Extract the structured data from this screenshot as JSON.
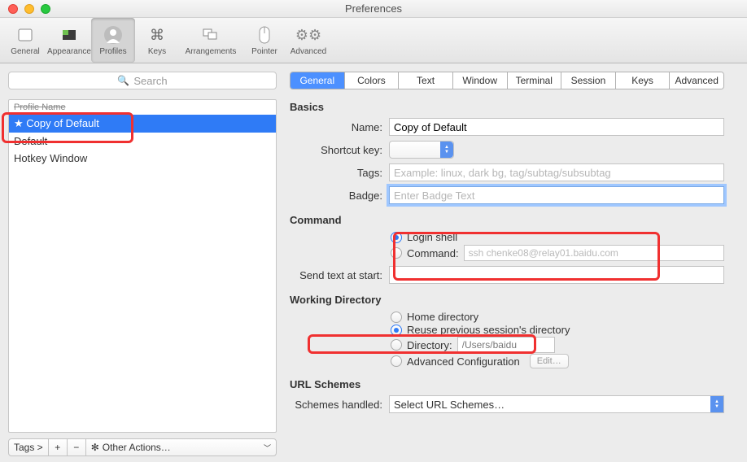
{
  "window": {
    "title": "Preferences"
  },
  "toolbar": {
    "items": [
      {
        "label": "General",
        "icon": "rect"
      },
      {
        "label": "Appearance",
        "icon": "swatch"
      },
      {
        "label": "Profiles",
        "icon": "person",
        "active": true
      },
      {
        "label": "Keys",
        "icon": "cmd"
      },
      {
        "label": "Arrangements",
        "icon": "windows"
      },
      {
        "label": "Pointer",
        "icon": "mouse"
      },
      {
        "label": "Advanced",
        "icon": "gears"
      }
    ]
  },
  "search": {
    "placeholder": "Search"
  },
  "profiles": {
    "header": "Profile Name",
    "items": [
      {
        "label": "★ Copy of Default",
        "selected": true
      },
      {
        "label": "Default"
      },
      {
        "label": "Hotkey Window"
      }
    ]
  },
  "sidebar_actions": {
    "tags": "Tags >",
    "plus": "+",
    "minus": "−",
    "other": "Other Actions…",
    "gear": "✻"
  },
  "tabs": [
    "General",
    "Colors",
    "Text",
    "Window",
    "Terminal",
    "Session",
    "Keys",
    "Advanced"
  ],
  "active_tab": "General",
  "sections": {
    "basics": {
      "heading": "Basics",
      "name_label": "Name:",
      "name_value": "Copy of Default",
      "shortcut_label": "Shortcut key:",
      "tags_label": "Tags:",
      "tags_placeholder": "Example: linux, dark bg, tag/subtag/subsubtag",
      "badge_label": "Badge:",
      "badge_placeholder": "Enter Badge Text"
    },
    "command": {
      "heading": "Command",
      "login_shell": "Login shell",
      "command_label": "Command:",
      "command_value": "ssh chenke08@relay01.baidu.com",
      "send_text_label": "Send text at start:"
    },
    "working": {
      "heading": "Working Directory",
      "home": "Home directory",
      "reuse": "Reuse previous session's directory",
      "directory_label": "Directory:",
      "directory_value": "/Users/baidu",
      "advanced": "Advanced Configuration",
      "edit": "Edit…"
    },
    "url": {
      "heading": "URL Schemes",
      "label": "Schemes handled:",
      "value": "Select URL Schemes…"
    }
  }
}
